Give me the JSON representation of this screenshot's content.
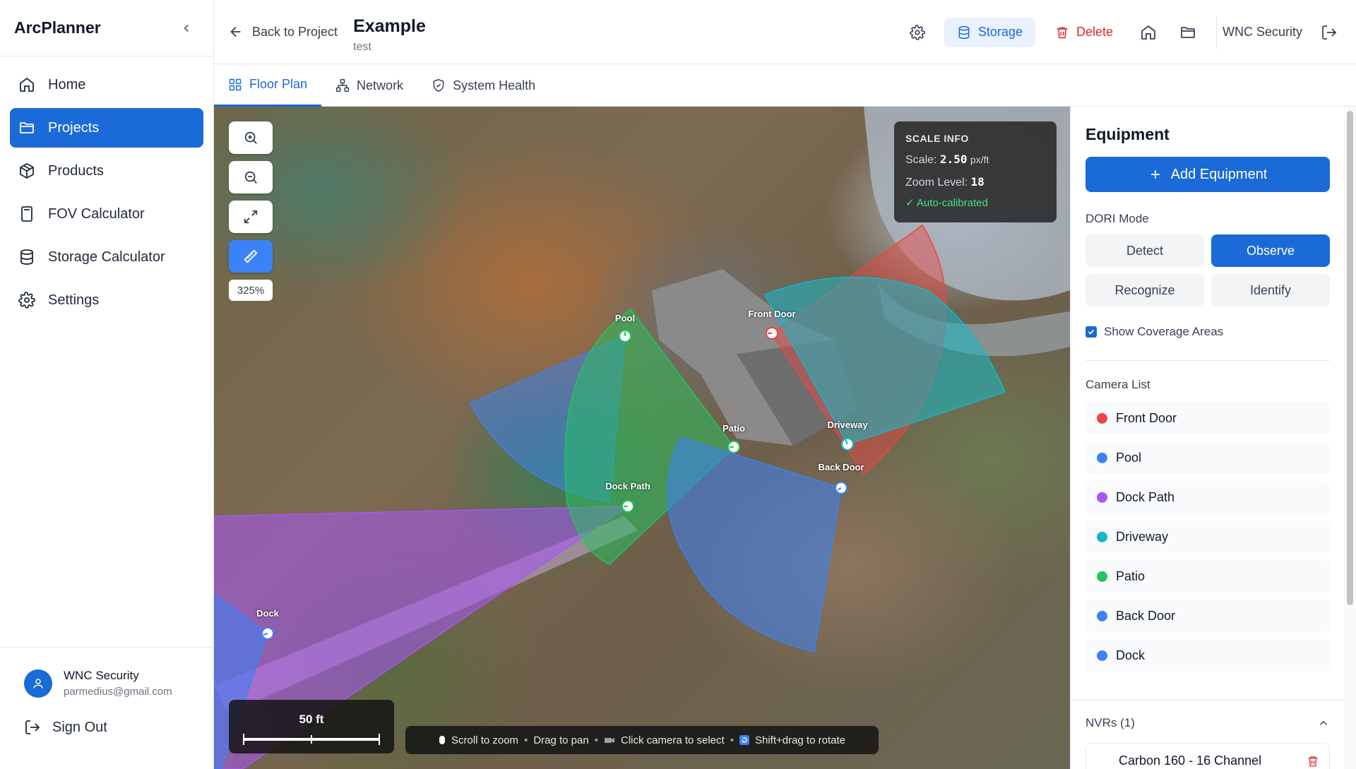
{
  "app": {
    "name": "ArcPlanner"
  },
  "sidebar": {
    "items": [
      {
        "label": "Home",
        "icon": "home-icon"
      },
      {
        "label": "Projects",
        "icon": "folder-icon",
        "active": true
      },
      {
        "label": "Products",
        "icon": "box-icon"
      },
      {
        "label": "FOV Calculator",
        "icon": "calculator-icon"
      },
      {
        "label": "Storage Calculator",
        "icon": "database-icon"
      },
      {
        "label": "Settings",
        "icon": "gear-icon"
      }
    ],
    "user": {
      "name": "WNC Security",
      "email": "parmedius@gmail.com"
    },
    "sign_out": "Sign Out"
  },
  "header": {
    "back_label": "Back to Project",
    "title": "Example",
    "subtitle": "test",
    "storage_label": "Storage",
    "delete_label": "Delete",
    "company": "WNC Security"
  },
  "tabs": [
    {
      "label": "Floor Plan",
      "icon": "grid-icon",
      "active": true
    },
    {
      "label": "Network",
      "icon": "network-icon"
    },
    {
      "label": "System Health",
      "icon": "shield-icon"
    }
  ],
  "map": {
    "zoom_percent": "325%",
    "scale_info": {
      "title": "SCALE INFO",
      "scale_label": "Scale:",
      "scale_value": "2.50",
      "scale_unit": "px/ft",
      "zoom_label": "Zoom Level:",
      "zoom_value": "18",
      "calibrated": "✓ Auto-calibrated"
    },
    "scalebar_label": "50 ft",
    "hints": [
      "Scroll to zoom",
      "Drag to pan",
      "Click camera to select",
      "Shift+drag to rotate"
    ],
    "camera_labels": [
      "Front Door",
      "Pool",
      "Patio",
      "Driveway",
      "Back Door",
      "Dock Path",
      "Dock"
    ]
  },
  "panel": {
    "title": "Equipment",
    "add_label": "Add Equipment",
    "dori_title": "DORI Mode",
    "dori_options": [
      "Detect",
      "Observe",
      "Recognize",
      "Identify"
    ],
    "dori_selected": "Observe",
    "coverage_label": "Show Coverage Areas",
    "coverage_checked": true,
    "camera_list_title": "Camera List",
    "cameras": [
      {
        "name": "Front Door",
        "color": "#ef4444"
      },
      {
        "name": "Pool",
        "color": "#3b82f6"
      },
      {
        "name": "Dock Path",
        "color": "#a855f7"
      },
      {
        "name": "Driveway",
        "color": "#14b8c6"
      },
      {
        "name": "Patio",
        "color": "#22c55e"
      },
      {
        "name": "Back Door",
        "color": "#3b82f6"
      },
      {
        "name": "Dock",
        "color": "#3b82f6"
      }
    ],
    "nvr_title": "NVRs (1)",
    "nvr_name": "Carbon 160 - 16 Channel"
  },
  "colors": {
    "accent": "#1a6ad8",
    "danger": "#dc2626"
  }
}
